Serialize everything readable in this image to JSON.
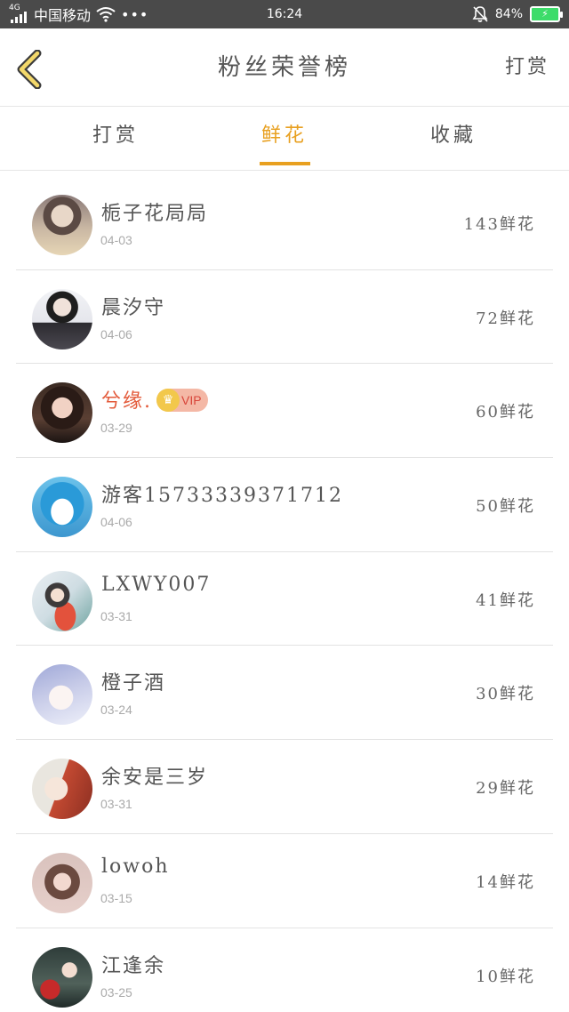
{
  "status_bar": {
    "network_type": "4G",
    "carrier": "中国移动",
    "more_indicator": "•••",
    "time": "16:24",
    "battery_percent": "84%",
    "icons": [
      "signal-icon",
      "wifi-icon",
      "mute-bell-icon",
      "battery-charging-icon"
    ]
  },
  "header": {
    "title": "粉丝荣誉榜",
    "action_label": "打赏",
    "back_icon": "chevron-left-icon"
  },
  "tabs": [
    {
      "label": "打赏",
      "active": false
    },
    {
      "label": "鲜花",
      "active": true
    },
    {
      "label": "收藏",
      "active": false
    }
  ],
  "colors": {
    "accent": "#e8a020",
    "vip_name": "#e35a3a",
    "status_bar": "#4a4a4a"
  },
  "fans": [
    {
      "name": "栀子花局局",
      "date": "04-03",
      "count": "143鲜花"
    },
    {
      "name": "晨汐守",
      "date": "04-06",
      "count": "72鲜花"
    },
    {
      "name": "兮缘.",
      "date": "03-29",
      "count": "60鲜花",
      "vip": true,
      "vip_label": "VIP"
    },
    {
      "name": "游客15733339371712",
      "date": "04-06",
      "count": "50鲜花"
    },
    {
      "name": "LXWY007",
      "date": "03-31",
      "count": "41鲜花"
    },
    {
      "name": "橙子酒",
      "date": "03-24",
      "count": "30鲜花"
    },
    {
      "name": "余安是三岁",
      "date": "03-31",
      "count": "29鲜花"
    },
    {
      "name": "lowoh",
      "date": "03-15",
      "count": "14鲜花"
    },
    {
      "name": "江逢余",
      "date": "03-25",
      "count": "10鲜花"
    }
  ]
}
